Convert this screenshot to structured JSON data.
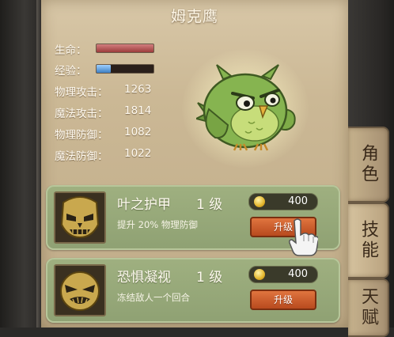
{
  "character": {
    "name": "姆克鹰",
    "hp_label": "生命：",
    "hp_fill": 1.0,
    "exp_label": "经验：",
    "exp_fill": 0.25,
    "stats": [
      {
        "label": "物理攻击：",
        "value": "1263"
      },
      {
        "label": "魔法攻击：",
        "value": "1814"
      },
      {
        "label": "物理防御：",
        "value": "1082"
      },
      {
        "label": "魔法防御：",
        "value": "1022"
      }
    ]
  },
  "tabs": [
    {
      "label": "角色"
    },
    {
      "label": "技能"
    },
    {
      "label": "天赋"
    }
  ],
  "skills": [
    {
      "name": "叶之护甲",
      "level": "1 级",
      "desc": "提升 20% 物理防御",
      "cost": "400",
      "button": "升级",
      "icon": "skull-mask-icon"
    },
    {
      "name": "恐惧凝视",
      "level": "1 级",
      "desc": "冻结敌人一个回合",
      "cost": "400",
      "button": "升级",
      "icon": "glaring-face-icon"
    }
  ],
  "colors": {
    "panel": "#cbb895",
    "card": "#98aa7a",
    "button": "#c95a28",
    "hp": "#b24a4a",
    "exp": "#5a97d6"
  }
}
